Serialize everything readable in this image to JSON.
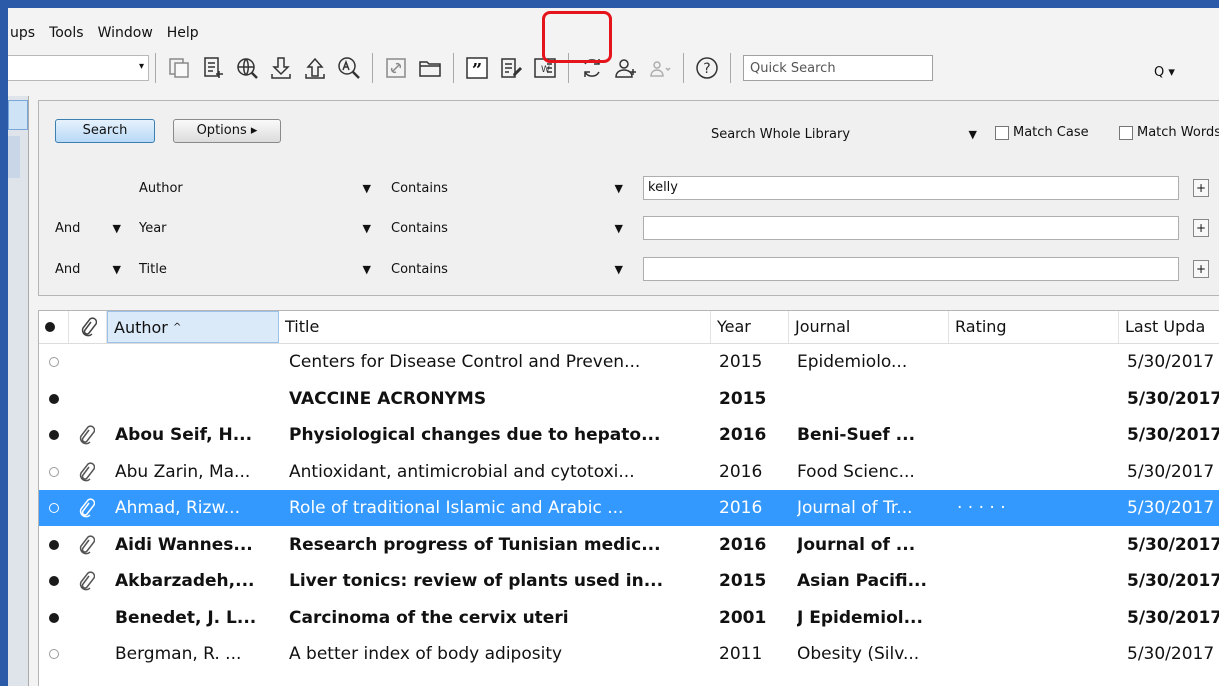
{
  "menu": [
    "ups",
    "Tools",
    "Window",
    "Help"
  ],
  "toolbar": {
    "icons": [
      "copy-formatted",
      "new-reference",
      "online-search",
      "import",
      "export",
      "find-fulltext",
      "open-link",
      "open-file",
      "insert-citation",
      "format-bibliography",
      "word-document",
      "sync",
      "share-group",
      "group-dropdown",
      "help"
    ],
    "quick_search_placeholder": "Quick Search",
    "quick_search_btn": "Q ▾"
  },
  "search": {
    "search_label": "Search",
    "options_label": "Options ▸",
    "scope": "Search Whole Library",
    "match_case": "Match Case",
    "match_words": "Match Words",
    "rows": [
      {
        "bool": "",
        "field": "Author",
        "op": "Contains",
        "value": "kelly"
      },
      {
        "bool": "And",
        "field": "Year",
        "op": "Contains",
        "value": ""
      },
      {
        "bool": "And",
        "field": "Title",
        "op": "Contains",
        "value": ""
      }
    ],
    "plus": "+"
  },
  "list": {
    "columns": {
      "author": "Author",
      "title": "Title",
      "year": "Year",
      "journal": "Journal",
      "rating": "Rating",
      "updated": "Last Upda"
    },
    "rows": [
      {
        "read": false,
        "attach": false,
        "bold": false,
        "selected": false,
        "author": "",
        "title": "Centers for Disease Control and Preven...",
        "year": "2015",
        "journal": "Epidemiolo...",
        "rating": "",
        "updated": "5/30/2017"
      },
      {
        "read": true,
        "attach": false,
        "bold": true,
        "selected": false,
        "author": "",
        "title": "VACCINE ACRONYMS",
        "year": "2015",
        "journal": "",
        "rating": "",
        "updated": "5/30/2017"
      },
      {
        "read": true,
        "attach": true,
        "bold": true,
        "selected": false,
        "author": "Abou Seif, H...",
        "title": "Physiological changes due to hepato...",
        "year": "2016",
        "journal": "Beni-Suef ...",
        "rating": "",
        "updated": "5/30/2017"
      },
      {
        "read": false,
        "attach": true,
        "bold": false,
        "selected": false,
        "author": "Abu Zarin, Ma...",
        "title": "Antioxidant, antimicrobial and cytotoxi...",
        "year": "2016",
        "journal": "Food Scienc...",
        "rating": "",
        "updated": "5/30/2017"
      },
      {
        "read": false,
        "attach": true,
        "bold": false,
        "selected": true,
        "author": "Ahmad, Rizw...",
        "title": "Role of traditional Islamic and Arabic ...",
        "year": "2016",
        "journal": "Journal of Tr...",
        "rating": "·  ·  ·  ·  ·",
        "updated": "5/30/2017"
      },
      {
        "read": true,
        "attach": true,
        "bold": true,
        "selected": false,
        "author": "Aidi Wannes...",
        "title": "Research progress of Tunisian medic...",
        "year": "2016",
        "journal": "Journal of ...",
        "rating": "",
        "updated": "5/30/2017"
      },
      {
        "read": true,
        "attach": true,
        "bold": true,
        "selected": false,
        "author": "Akbarzadeh,...",
        "title": "Liver tonics: review of plants used in...",
        "year": "2015",
        "journal": "Asian Pacifi...",
        "rating": "",
        "updated": "5/30/2017"
      },
      {
        "read": true,
        "attach": false,
        "bold": true,
        "selected": false,
        "author": "Benedet, J. L...",
        "title": "Carcinoma of the cervix uteri",
        "year": "2001",
        "journal": "J Epidemiol...",
        "rating": "",
        "updated": "5/30/2017"
      },
      {
        "read": false,
        "attach": false,
        "bold": false,
        "selected": false,
        "author": "Bergman, R. ...",
        "title": "A better index of body adiposity",
        "year": "2011",
        "journal": "Obesity (Silv...",
        "rating": "",
        "updated": "5/30/2017"
      }
    ]
  },
  "colors": {
    "highlight": "#e5141b",
    "selection": "#3399ff",
    "frame": "#2b5aa8"
  }
}
